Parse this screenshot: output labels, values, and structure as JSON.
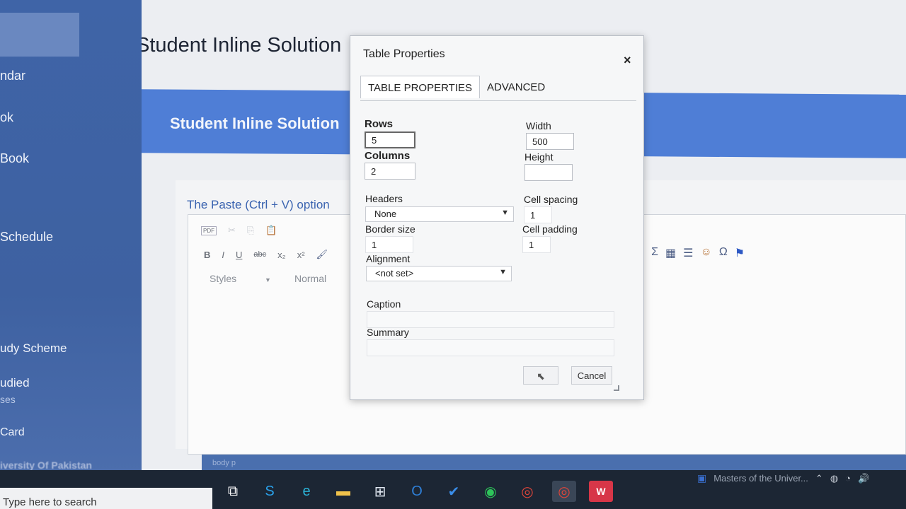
{
  "sidebar": {
    "items": [
      {
        "label": "ndar"
      },
      {
        "label": "ok"
      },
      {
        "label": "Book"
      },
      {
        "label": "Schedule"
      },
      {
        "label": "udy Scheme"
      },
      {
        "label": "udied"
      },
      {
        "label": "Card"
      }
    ],
    "sub_label": "ses",
    "footer": "iversity Of Pakistan"
  },
  "page": {
    "title": "Student Inline Solution",
    "banner_title": "Student Inline Solution",
    "paste_note": "The Paste (Ctrl + V) option"
  },
  "editor": {
    "toolbar": {
      "bold": "B",
      "italic": "I",
      "underline": "U",
      "strike": "abc",
      "subscript": "x₂",
      "superscript": "x²"
    },
    "styles_label": "Styles",
    "format_label": "Normal",
    "status_path": "body  p"
  },
  "dialog": {
    "title": "Table Properties",
    "close": "×",
    "tabs": [
      {
        "label": "TABLE PROPERTIES",
        "active": true
      },
      {
        "label": "ADVANCED",
        "active": false
      }
    ],
    "rows_label": "Rows",
    "rows_value": "5",
    "columns_label": "Columns",
    "columns_value": "2",
    "width_label": "Width",
    "width_value": "500",
    "height_label": "Height",
    "height_value": "",
    "headers_label": "Headers",
    "headers_value": "None",
    "cell_spacing_label": "Cell spacing",
    "cell_spacing_value": "1",
    "border_size_label": "Border size",
    "border_size_value": "1",
    "cell_padding_label": "Cell padding",
    "cell_padding_value": "1",
    "alignment_label": "Alignment",
    "alignment_value": "<not set>",
    "caption_label": "Caption",
    "summary_label": "Summary",
    "cancel_label": "Cancel"
  },
  "taskbar": {
    "search_placeholder": "Type here to search",
    "active_window": "Masters of the Univer..."
  },
  "colors": {
    "sidebar": "#3f64a7",
    "banner": "#4f7ed6",
    "taskbar": "#1c2634",
    "link": "#3a63b0"
  }
}
